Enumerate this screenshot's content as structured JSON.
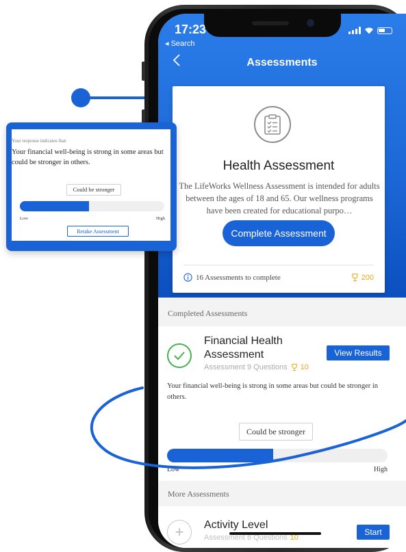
{
  "status_bar": {
    "time": "17:23",
    "back_label": "◂ Search"
  },
  "header": {
    "title": "Assessments"
  },
  "hero": {
    "title": "Health Assessment",
    "description": "The LifeWorks Wellness Assessment is intended for adults between the ages of 18 and 65. Our wellness programs have been created for educational purpo…",
    "button_label": "Complete Assessment",
    "assessments_to_complete": "16 Assessments to complete",
    "points": "200"
  },
  "completed": {
    "section_label": "Completed Assessments",
    "item": {
      "title": "Financial Health Assessment",
      "meta": "Assessment 9 Questions",
      "points": "10",
      "button_label": "View Results",
      "result_text": "Your financial well-being is strong in some areas but could be stronger in others.",
      "bubble_label": "Could be stronger",
      "level": 0.48,
      "low_label": "Low",
      "high_label": "High"
    }
  },
  "more": {
    "section_label": "More Assessments",
    "item": {
      "title": "Activity Level",
      "meta": "Assessment 6 Questions",
      "points": "10",
      "button_label": "Start"
    }
  },
  "popup": {
    "intro": "Your response indicates that:",
    "message": "Your financial well-being is strong in some areas but could be stronger in others.",
    "bubble_label": "Could be stronger",
    "level": 0.48,
    "low_label": "Low",
    "high_label": "High",
    "button_label": "Retake Assessment"
  },
  "colors": {
    "accent": "#1a63d6",
    "success": "#43b24b",
    "points": "#e6a613"
  }
}
